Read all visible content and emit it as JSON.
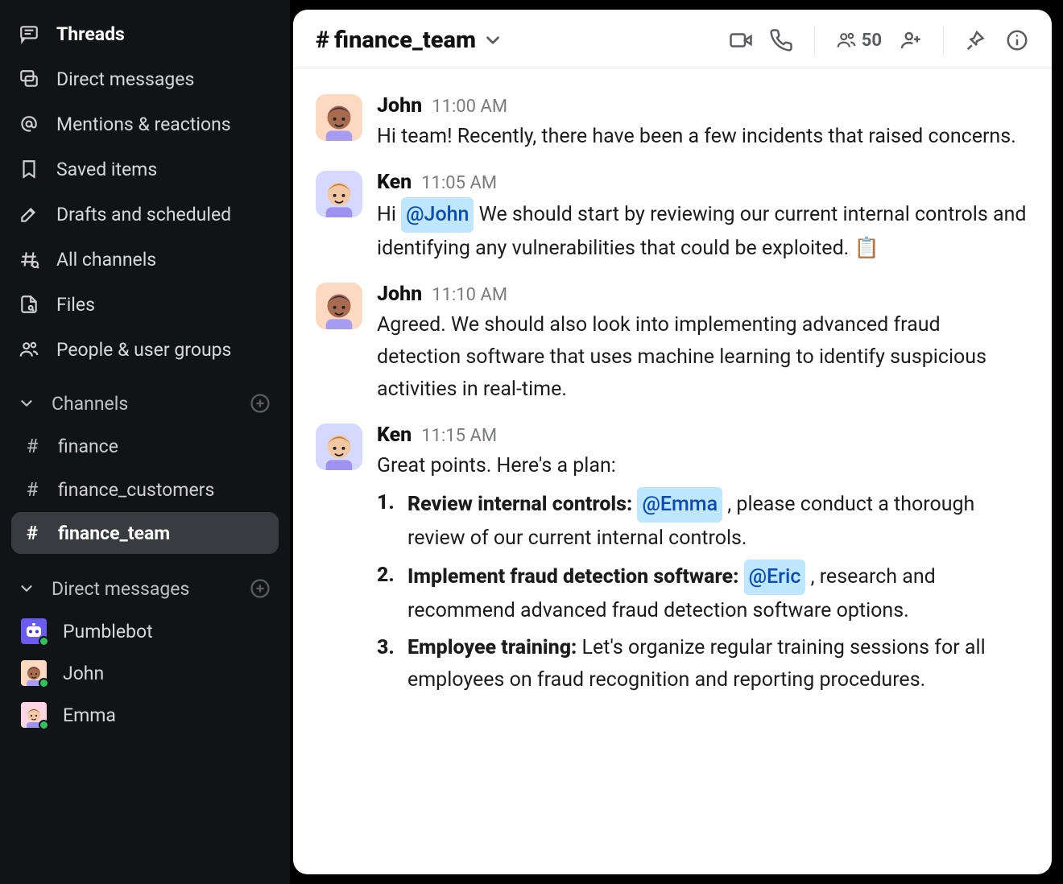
{
  "sidebar": {
    "nav": [
      {
        "icon": "threads",
        "label": "Threads",
        "bold": true
      },
      {
        "icon": "dms",
        "label": "Direct messages",
        "bold": false
      },
      {
        "icon": "mentions",
        "label": "Mentions & reactions",
        "bold": false
      },
      {
        "icon": "saved",
        "label": "Saved items",
        "bold": false
      },
      {
        "icon": "drafts",
        "label": "Drafts and scheduled",
        "bold": false
      },
      {
        "icon": "all",
        "label": "All channels",
        "bold": false
      },
      {
        "icon": "files",
        "label": "Files",
        "bold": false
      },
      {
        "icon": "people",
        "label": "People & user groups",
        "bold": false
      }
    ],
    "sections": {
      "channels_label": "Channels",
      "dms_label": "Direct messages"
    },
    "channels": [
      {
        "name": "finance",
        "active": false
      },
      {
        "name": "finance_customers",
        "active": false
      },
      {
        "name": "finance_team",
        "active": true
      }
    ],
    "dms": [
      {
        "name": "Pumblebot",
        "avatar": "bot"
      },
      {
        "name": "John",
        "avatar": "john"
      },
      {
        "name": "Emma",
        "avatar": "emma"
      }
    ]
  },
  "header": {
    "channel_name": "finance_team",
    "member_count": "50"
  },
  "messages": [
    {
      "user": "John",
      "avatar": "john",
      "time": "11:00 AM",
      "parts": [
        {
          "t": "text",
          "v": "Hi team! Recently, there have been a few incidents that raised concerns."
        }
      ]
    },
    {
      "user": "Ken",
      "avatar": "ken",
      "time": "11:05 AM",
      "parts": [
        {
          "t": "text",
          "v": "Hi "
        },
        {
          "t": "mention",
          "v": "@John"
        },
        {
          "t": "text",
          "v": " We should start by reviewing our current internal controls and identifying any vulnerabilities that could be exploited. 📋"
        }
      ]
    },
    {
      "user": "John",
      "avatar": "john",
      "time": "11:10 AM",
      "parts": [
        {
          "t": "text",
          "v": "Agreed. We should also look into implementing advanced fraud detection software that uses machine learning to identify suspicious activities in real-time."
        }
      ]
    },
    {
      "user": "Ken",
      "avatar": "ken",
      "time": "11:15 AM",
      "intro": "Great points. Here's a plan:",
      "list": [
        {
          "lead": "Review internal controls:",
          "segments": [
            {
              "t": "text",
              "v": " "
            },
            {
              "t": "mention",
              "v": "@Emma"
            },
            {
              "t": "text",
              "v": " , please conduct a thorough review of our current internal controls."
            }
          ]
        },
        {
          "lead": "Implement fraud detection software:",
          "segments": [
            {
              "t": "text",
              "v": " "
            },
            {
              "t": "mention",
              "v": "@Eric"
            },
            {
              "t": "text",
              "v": " , research and recommend advanced fraud detection software options."
            }
          ]
        },
        {
          "lead": "Employee training:",
          "segments": [
            {
              "t": "text",
              "v": " Let's organize regular training sessions for all employees on fraud recognition and reporting procedures."
            }
          ]
        }
      ]
    }
  ],
  "avatars": {
    "john": {
      "bg": "#fcd9c0",
      "hair": "#3b2b4a",
      "skin": "#a86b50",
      "shirt": "#a79cf2"
    },
    "ken": {
      "bg": "#d5d9ff",
      "hair": "#b97c3b",
      "skin": "#f3c7a3",
      "shirt": "#9f92f0"
    },
    "emma": {
      "bg": "#ffd5e3",
      "hair": "#6b3b2b",
      "skin": "#f5cba7",
      "shirt": "#9f92f0"
    },
    "bot": {
      "bg": "#6a5cf0",
      "hair": "#ffffff",
      "skin": "#ffffff",
      "shirt": "#3c2fcf"
    }
  }
}
